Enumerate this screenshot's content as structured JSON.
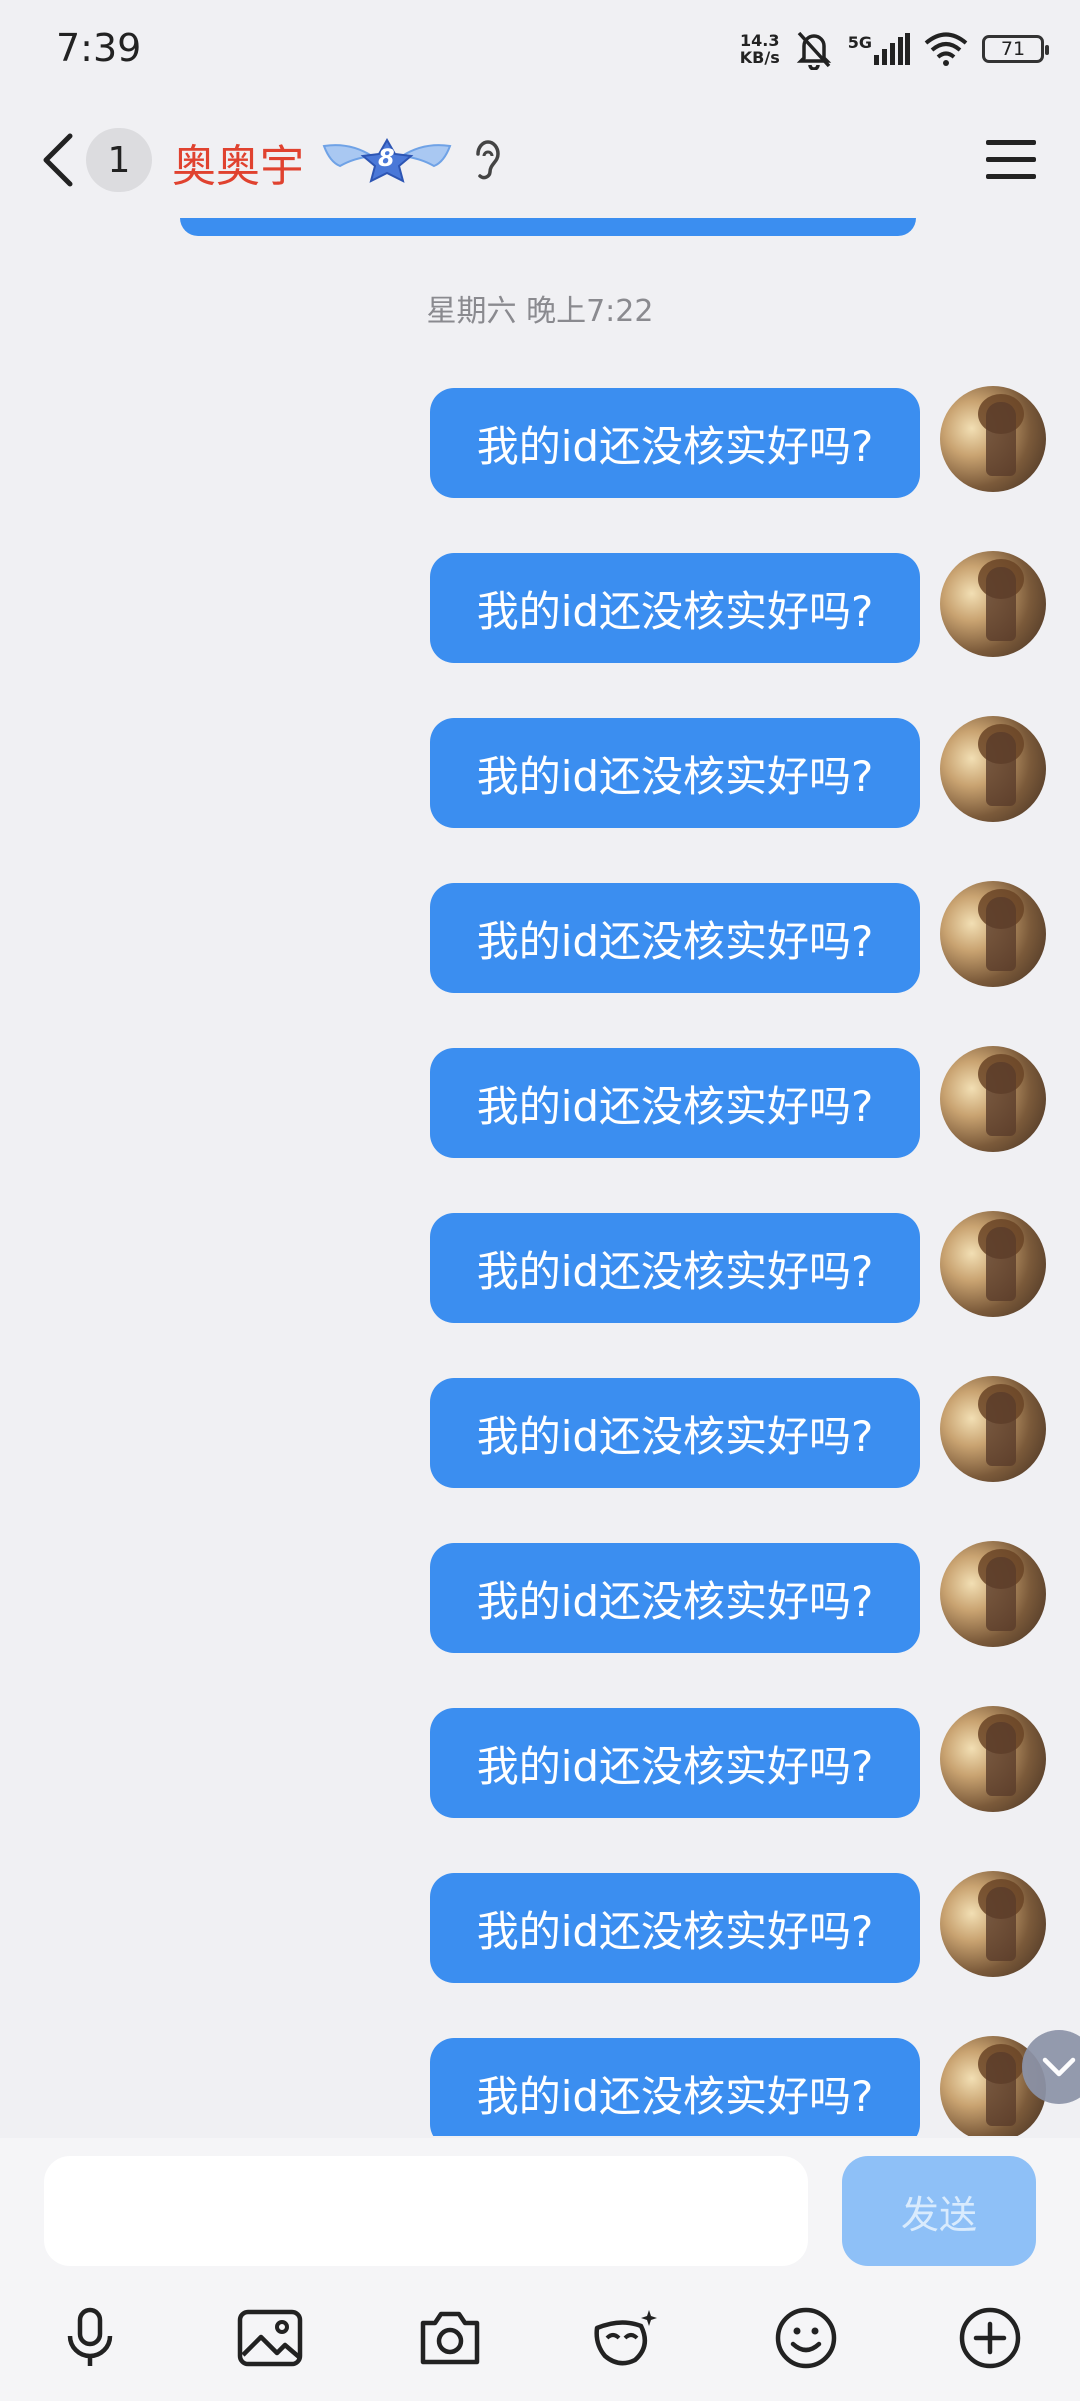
{
  "status_bar": {
    "time": "7:39",
    "net_speed_top": "14.3",
    "net_speed_bottom": "KB/s",
    "network": "5G",
    "battery": "71"
  },
  "header": {
    "unread_count": "1",
    "contact_name": "奥奥宇",
    "level": "8"
  },
  "timestamp": "星期六 晚上7:22",
  "messages": [
    {
      "text": "我的id还没核实好吗?"
    },
    {
      "text": "我的id还没核实好吗?"
    },
    {
      "text": "我的id还没核实好吗?"
    },
    {
      "text": "我的id还没核实好吗?"
    },
    {
      "text": "我的id还没核实好吗?"
    },
    {
      "text": "我的id还没核实好吗?"
    },
    {
      "text": "我的id还没核实好吗?"
    },
    {
      "text": "我的id还没核实好吗?"
    },
    {
      "text": "我的id还没核实好吗?"
    },
    {
      "text": "我的id还没核实好吗?"
    },
    {
      "text": "我的id还没核实好吗?"
    }
  ],
  "input": {
    "value": "",
    "send_label": "发送"
  },
  "toolbar": [
    "microphone-icon",
    "image-icon",
    "camera-icon",
    "mask-icon",
    "emoji-icon",
    "plus-icon"
  ],
  "colors": {
    "bubble": "#3b8ef0",
    "name": "#e0422f",
    "background": "#f0f0f3",
    "send_disabled": "#8ec0f7"
  }
}
